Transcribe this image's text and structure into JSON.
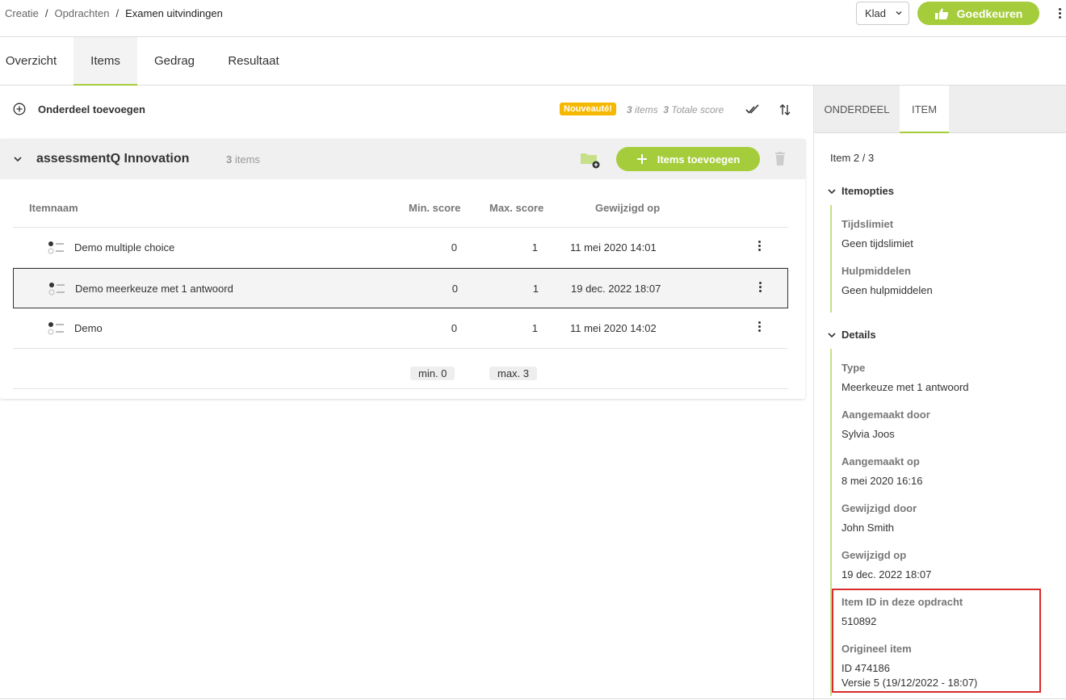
{
  "breadcrumb": {
    "items": [
      "Creatie",
      "Opdrachten"
    ],
    "current": "Examen uitvindingen",
    "separator": "/"
  },
  "header": {
    "status_value": "Klad",
    "approve_label": "Goedkeuren"
  },
  "tabs": [
    {
      "label": "Overzicht",
      "active": false
    },
    {
      "label": "Items",
      "active": true
    },
    {
      "label": "Gedrag",
      "active": false
    },
    {
      "label": "Resultaat",
      "active": false
    }
  ],
  "toolbar": {
    "add_section_label": "Onderdeel toevoegen",
    "new_badge": "Nouveauté!",
    "items_count": "3",
    "items_word": "items",
    "total_score": "3",
    "total_score_label": "Totale score"
  },
  "section": {
    "title": "assessmentQ Innovation",
    "count": "3",
    "count_word": "items",
    "add_items_label": "Items toevoegen"
  },
  "table": {
    "headers": {
      "name": "Itemnaam",
      "min": "Min. score",
      "max": "Max. score",
      "modified": "Gewijzigd op"
    },
    "rows": [
      {
        "name": "Demo multiple choice",
        "min": "0",
        "max": "1",
        "modified": "11 mei 2020 14:01",
        "selected": false
      },
      {
        "name": "Demo meerkeuze met 1 antwoord",
        "min": "0",
        "max": "1",
        "modified": "19 dec. 2022 18:07",
        "selected": true
      },
      {
        "name": "Demo",
        "min": "0",
        "max": "1",
        "modified": "11 mei 2020 14:02",
        "selected": false
      }
    ],
    "footer": {
      "min": "min. 0",
      "max": "max. 3"
    }
  },
  "panel": {
    "tabs": [
      {
        "label": "ONDERDEEL",
        "active": false
      },
      {
        "label": "ITEM",
        "active": true
      }
    ],
    "counter": "Item 2 / 3",
    "itemopties": {
      "title": "Itemopties",
      "fields": [
        {
          "label": "Tijdslimiet",
          "value": "Geen tijdslimiet"
        },
        {
          "label": "Hulpmiddelen",
          "value": "Geen hulpmiddelen"
        }
      ]
    },
    "details": {
      "title": "Details",
      "fields": [
        {
          "label": "Type",
          "value": "Meerkeuze met 1 antwoord"
        },
        {
          "label": "Aangemaakt door",
          "value": "Sylvia Joos"
        },
        {
          "label": "Aangemaakt op",
          "value": "8 mei 2020 16:16"
        },
        {
          "label": "Gewijzigd door",
          "value": "John Smith"
        },
        {
          "label": "Gewijzigd op",
          "value": "19 dec. 2022 18:07"
        },
        {
          "label": "Item ID in deze opdracht",
          "value": "510892"
        },
        {
          "label": "Origineel item",
          "value": "ID 474186",
          "value2": "Versie 5 (19/12/2022 - 18:07)"
        }
      ]
    }
  },
  "colors": {
    "accent": "#a5cc3b",
    "badge": "#f5b800",
    "highlight": "#d92c2c"
  }
}
